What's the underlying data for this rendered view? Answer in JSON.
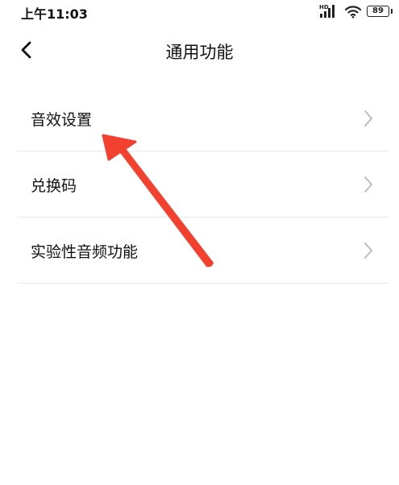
{
  "status_bar": {
    "time": "上午11:03",
    "network_badge": "HD",
    "battery_level": "89",
    "icons": [
      "signal-icon",
      "wifi-icon",
      "battery-icon"
    ]
  },
  "nav": {
    "title": "通用功能",
    "back_icon": "chevron-left-icon"
  },
  "menu": {
    "items": [
      {
        "label": "音效设置"
      },
      {
        "label": "兑换码"
      },
      {
        "label": "实验性音频功能"
      }
    ],
    "chevron_icon": "chevron-right-icon"
  },
  "annotation": {
    "type": "red-arrow",
    "color": "#f2412f",
    "points_to": "音效设置"
  },
  "colors": {
    "background": "#ffffff",
    "text": "#111111",
    "divider": "#e8e8e8",
    "chevron": "#b8bcc4",
    "annotation": "#f2412f"
  }
}
